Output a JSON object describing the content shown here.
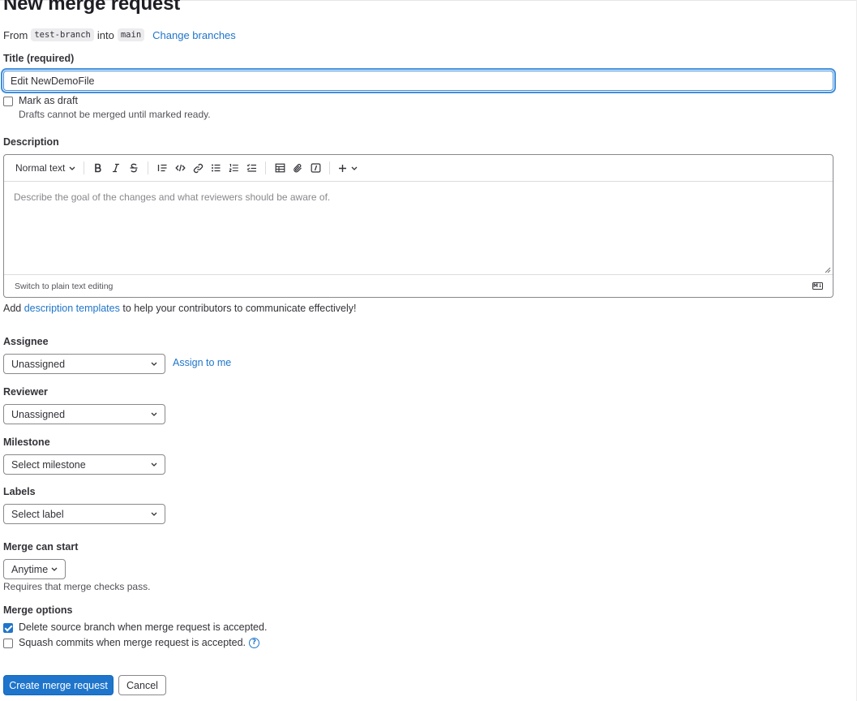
{
  "page": {
    "title": "New merge request"
  },
  "branches": {
    "from_prefix": "From",
    "source": "test-branch",
    "into_word": "into",
    "target": "main",
    "change_link": "Change branches"
  },
  "title_field": {
    "label": "Title (required)",
    "value": "Edit NewDemoFile"
  },
  "draft": {
    "label": "Mark as draft",
    "checked": false,
    "help": "Drafts cannot be merged until marked ready."
  },
  "description": {
    "label": "Description",
    "toolbar": {
      "text_style": "Normal text",
      "buttons": [
        "bold-icon",
        "italic-icon",
        "strikethrough-icon",
        "blockquote-icon",
        "code-icon",
        "link-icon",
        "bullet-list-icon",
        "numbered-list-icon",
        "task-list-icon",
        "table-icon",
        "attach-icon",
        "more-formatting-icon",
        "plus-icon"
      ]
    },
    "placeholder": "Describe the goal of the changes and what reviewers should be aware of.",
    "switch_link": "Switch to plain text editing",
    "help_prefix": "Add",
    "help_link": "description templates",
    "help_suffix": "to help your contributors to communicate effectively!"
  },
  "assignee": {
    "label": "Assignee",
    "value": "Unassigned",
    "assign_me": "Assign to me"
  },
  "reviewer": {
    "label": "Reviewer",
    "value": "Unassigned"
  },
  "milestone": {
    "label": "Milestone",
    "value": "Select milestone"
  },
  "labels": {
    "label": "Labels",
    "value": "Select label"
  },
  "merge_start": {
    "label": "Merge can start",
    "value": "Anytime",
    "help": "Requires that merge checks pass."
  },
  "merge_options": {
    "label": "Merge options",
    "delete_source": {
      "label": "Delete source branch when merge request is accepted.",
      "checked": true
    },
    "squash": {
      "label": "Squash commits when merge request is accepted.",
      "checked": false
    }
  },
  "actions": {
    "create": "Create merge request",
    "cancel": "Cancel"
  },
  "colors": {
    "accent": "#1f75cb",
    "text": "#333238",
    "border": "#89888d"
  }
}
